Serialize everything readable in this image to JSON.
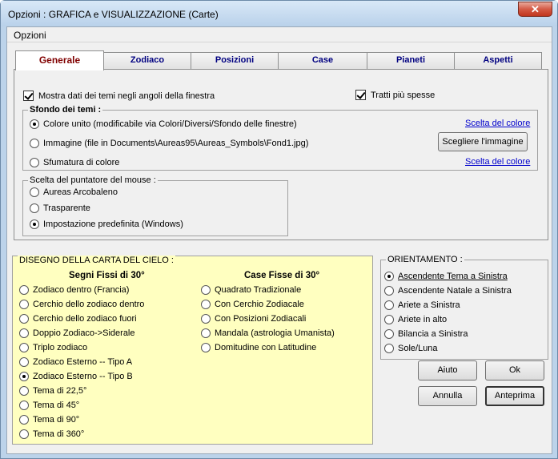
{
  "window": {
    "title": "Opzioni :  GRAFICA e VISUALIZZAZIONE (Carte)",
    "close_glyph": "✕"
  },
  "menubar": {
    "items": [
      "Opzioni"
    ]
  },
  "tabs": [
    "Generale",
    "Zodiaco",
    "Posizioni",
    "Case",
    "Pianeti",
    "Aspetti"
  ],
  "general": {
    "show_data_label": "Mostra dati dei temi negli angoli della finestra",
    "thick_lines_label": "Tratti più spesse",
    "background": {
      "title": "Sfondo dei temi :",
      "options": [
        "Colore unito (modificabile via Colori/Diversi/Sfondo delle finestre)",
        "Immagine (file in Documents\\Aureas95\\Aureas_Symbols\\Fond1.jpg)",
        "Sfumatura di colore"
      ],
      "color_link_1": "Scelta del colore",
      "choose_image_button": "Scegliere l'immagine",
      "color_link_2": "Scelta del colore"
    },
    "pointer": {
      "title": "Scelta del puntatore del mouse :",
      "options": [
        "Aureas Arcobaleno",
        "Trasparente",
        "Impostazione predefinita (Windows)"
      ]
    }
  },
  "drawing": {
    "title": "DISEGNO DELLA CARTA DEL CIELO :",
    "signs_header": "Segni Fissi di 30°",
    "houses_header": "Case Fisse di 30°",
    "signs_options": [
      "Zodiaco dentro (Francia)",
      "Cerchio dello zodiaco dentro",
      "Cerchio dello zodiaco fuori",
      "Doppio Zodiaco->Siderale",
      "Triplo zodiaco",
      "Zodiaco Esterno -- Tipo A",
      "Zodiaco Esterno -- Tipo B",
      "Tema di 22,5°",
      "Tema di 45°",
      "Tema di 90°",
      "Tema di 360°"
    ],
    "houses_options": [
      "Quadrato Tradizionale",
      "Con Cerchio Zodiacale",
      "Con Posizioni Zodiacali",
      "Mandala (astrologia Umanista)",
      "Domitudine con Latitudine"
    ]
  },
  "orientation": {
    "title": "ORIENTAMENTO :",
    "options": [
      "Ascendente Tema a Sinistra",
      "Ascendente Natale a Sinistra",
      "Ariete a Sinistra",
      "Ariete in alto",
      "Bilancia a Sinistra",
      "Sole/Luna"
    ]
  },
  "buttons": {
    "help": "Aiuto",
    "ok": "Ok",
    "cancel": "Annulla",
    "preview": "Anteprima"
  }
}
